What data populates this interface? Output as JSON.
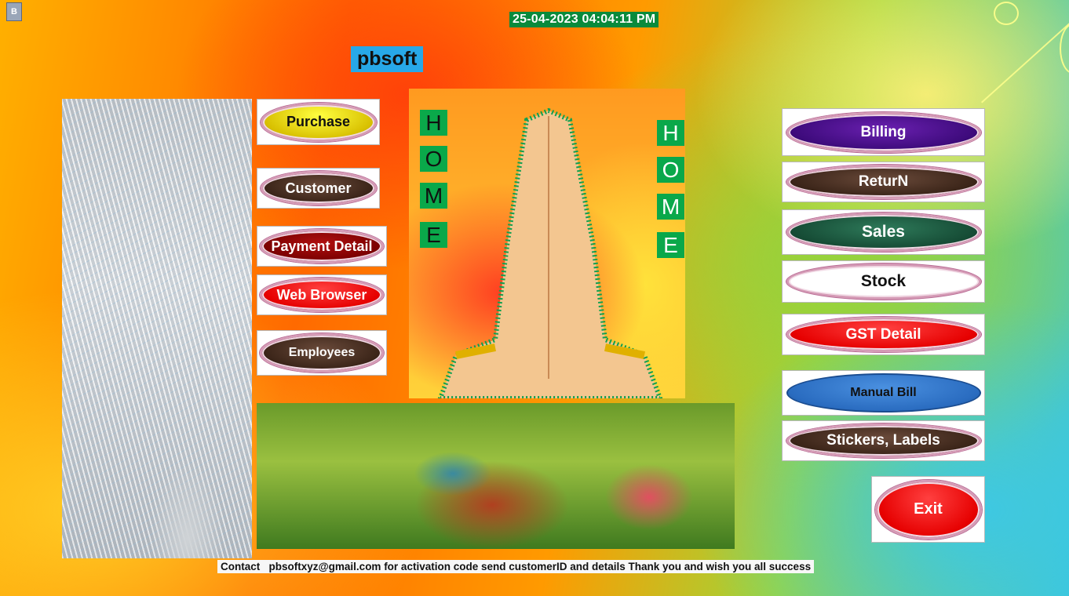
{
  "header": {
    "datetime": "25-04-2023 04:04:11 PM",
    "brand": "pbsoft",
    "app_icon_glyph": "B"
  },
  "home_banner": {
    "left_letters": [
      "H",
      "O",
      "M",
      "E"
    ],
    "right_letters": [
      "H",
      "O",
      "M",
      "E"
    ]
  },
  "left_menu": [
    {
      "label": "Purchase"
    },
    {
      "label": "Customer"
    },
    {
      "label": "Payment Detail"
    },
    {
      "label": "Web Browser"
    },
    {
      "label": "Employees"
    }
  ],
  "right_menu": [
    {
      "label": "Billing"
    },
    {
      "label": "ReturN"
    },
    {
      "label": "Sales"
    },
    {
      "label": "Stock"
    },
    {
      "label": "GST Detail"
    },
    {
      "label": "Manual Bill"
    },
    {
      "label": "Stickers, Labels"
    }
  ],
  "exit": {
    "label": "Exit"
  },
  "footer": {
    "text": "Contact   pbsoftxyz@gmail.com for activation code send customerID and details Thank you and wish you all success"
  },
  "colors": {
    "clock_bg": "#0a8a3c",
    "brand_bg": "#27a8e8",
    "home_letter_bg": "#0aa84a"
  },
  "icons": [
    "app-icon"
  ],
  "images": [
    "white-peacock-image",
    "praying-hands-image",
    "peacock-pair-image"
  ]
}
